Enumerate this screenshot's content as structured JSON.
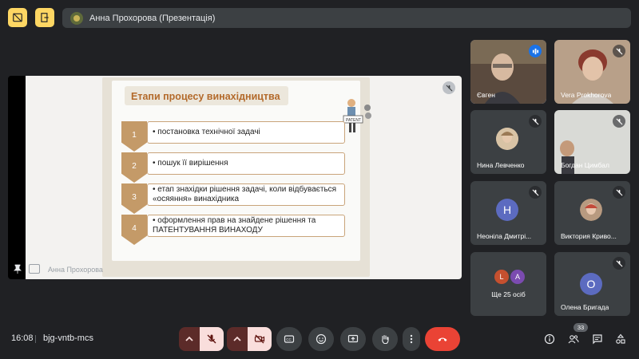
{
  "header": {
    "presenter_title": "Анна Прохорова (Презентація)"
  },
  "slide": {
    "title": "Етапи процесу винахідництва",
    "clipart_label": "PATENT",
    "steps": [
      {
        "num": "1",
        "text": "• постановка технічної задачі"
      },
      {
        "num": "2",
        "text": "• пошук її вирішення"
      },
      {
        "num": "3",
        "text": "• етап знахідки рішення задачі, коли відбувається «осяяння» винахідника"
      },
      {
        "num": "4",
        "text": "• оформлення прав на знайдене рішення та ПАТЕНТУВАННЯ ВИНАХОДУ"
      }
    ]
  },
  "stage": {
    "presenter_name": "Анна Прохорова"
  },
  "participants": [
    {
      "name": "Євген",
      "type": "video",
      "speaking": true
    },
    {
      "name": "Vera Prokhorova",
      "type": "video"
    },
    {
      "name": "Нина Левченко",
      "type": "photo"
    },
    {
      "name": "Богдан Цимбал",
      "type": "video"
    },
    {
      "name": "Неоніла Дмитрі...",
      "type": "letter",
      "letter": "Н",
      "color": "#5c6bc0"
    },
    {
      "name": "Виктория Криво...",
      "type": "photo"
    },
    {
      "name": "Ще 25 осіб",
      "type": "more",
      "letters": [
        "L",
        "A"
      ]
    },
    {
      "name": "Олена Бригада",
      "type": "letter",
      "letter": "О",
      "color": "#5c6bc0"
    }
  ],
  "footer": {
    "time": "16:08",
    "meeting_code": "bjg-vntb-mcs",
    "participant_count": "33"
  },
  "colors": {
    "accent_yellow": "#fdd663",
    "end_call_red": "#ea4335",
    "active_blue": "#8ab4f8"
  }
}
